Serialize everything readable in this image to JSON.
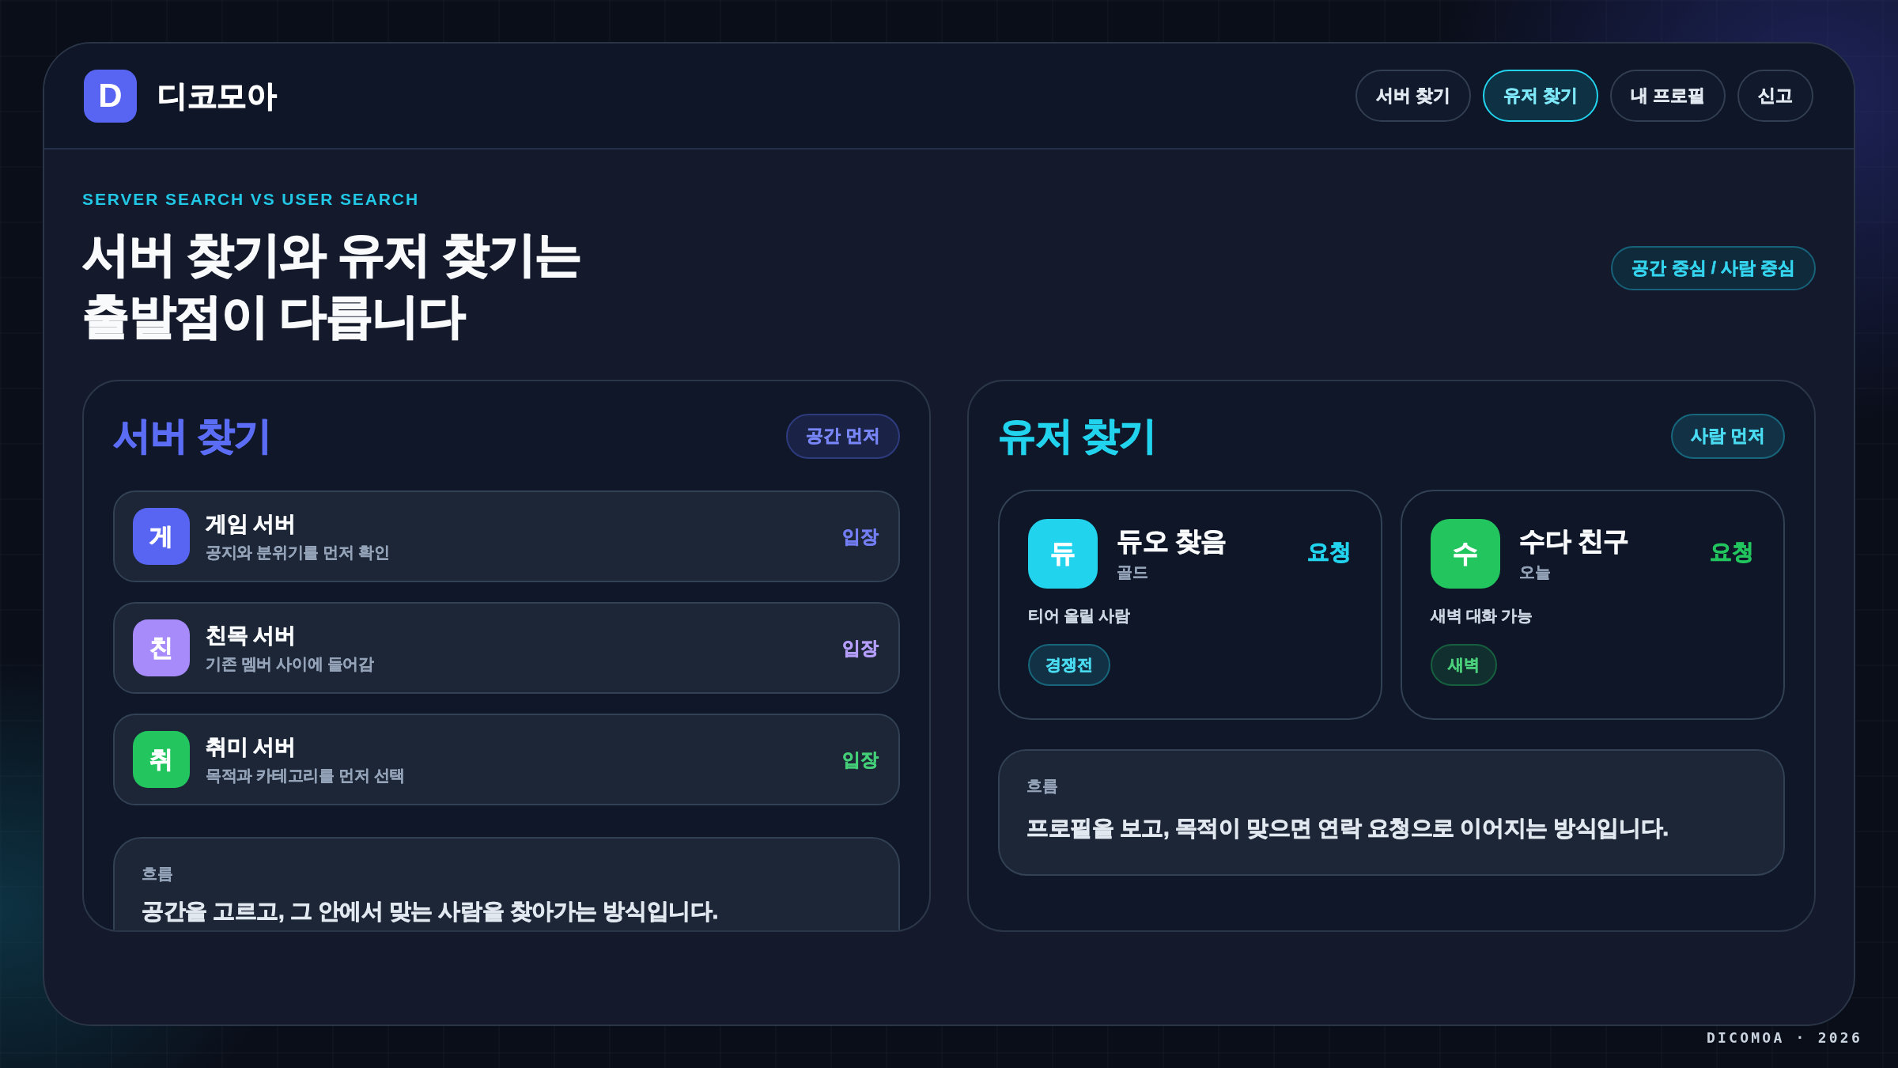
{
  "brand": {
    "logo_letter": "D",
    "name": "디코모아"
  },
  "nav": [
    {
      "label": "서버 찾기",
      "selected": false
    },
    {
      "label": "유저 찾기",
      "selected": true
    },
    {
      "label": "내 프로필",
      "selected": false
    },
    {
      "label": "신고",
      "selected": false
    }
  ],
  "hero": {
    "eyebrow": "SERVER SEARCH VS USER SEARCH",
    "title_lines": [
      "서버 찾기와 유저 찾기는",
      "출발점이 다릅니다"
    ],
    "badge": "공간 중심 / 사람 중심"
  },
  "panels": [
    {
      "kind": "server",
      "title": "서버 찾기",
      "color": "#5b6cf5",
      "badge": "공간 먼저",
      "items": [
        {
          "initial": "게",
          "name": "게임 서버",
          "description": "공지와 분위기를 먼저 확인",
          "action": "입장",
          "color": "#5865f2"
        },
        {
          "initial": "친",
          "name": "친목 서버",
          "description": "기존 멤버 사이에 들어감",
          "action": "입장",
          "color": "#a78bfa"
        },
        {
          "initial": "취",
          "name": "취미 서버",
          "description": "목적과 카테고리를 먼저 선택",
          "action": "입장",
          "color": "#22c55e"
        }
      ],
      "flow": {
        "label": "흐름",
        "text": "공간을 고르고, 그 안에서 맞는 사람을 찾아가는 방식입니다."
      }
    },
    {
      "kind": "user",
      "title": "유저 찾기",
      "color": "#22d3ee",
      "badge": "사람 먼저",
      "items": [
        {
          "initial": "듀",
          "name": "듀오 찾음",
          "subtitle": "골드",
          "description": "티어 올릴 사람",
          "tag": "경쟁전",
          "action": "요청",
          "color": "#22d3ee"
        },
        {
          "initial": "수",
          "name": "수다 친구",
          "subtitle": "오늘",
          "description": "새벽 대화 가능",
          "tag": "새벽",
          "action": "요청",
          "color": "#22c55e"
        }
      ],
      "flow": {
        "label": "흐름",
        "text": "프로필을 보고, 목적이 맞으면 연락 요청으로 이어지는 방식입니다."
      }
    }
  ],
  "footer": "DICOMOA · 2026"
}
